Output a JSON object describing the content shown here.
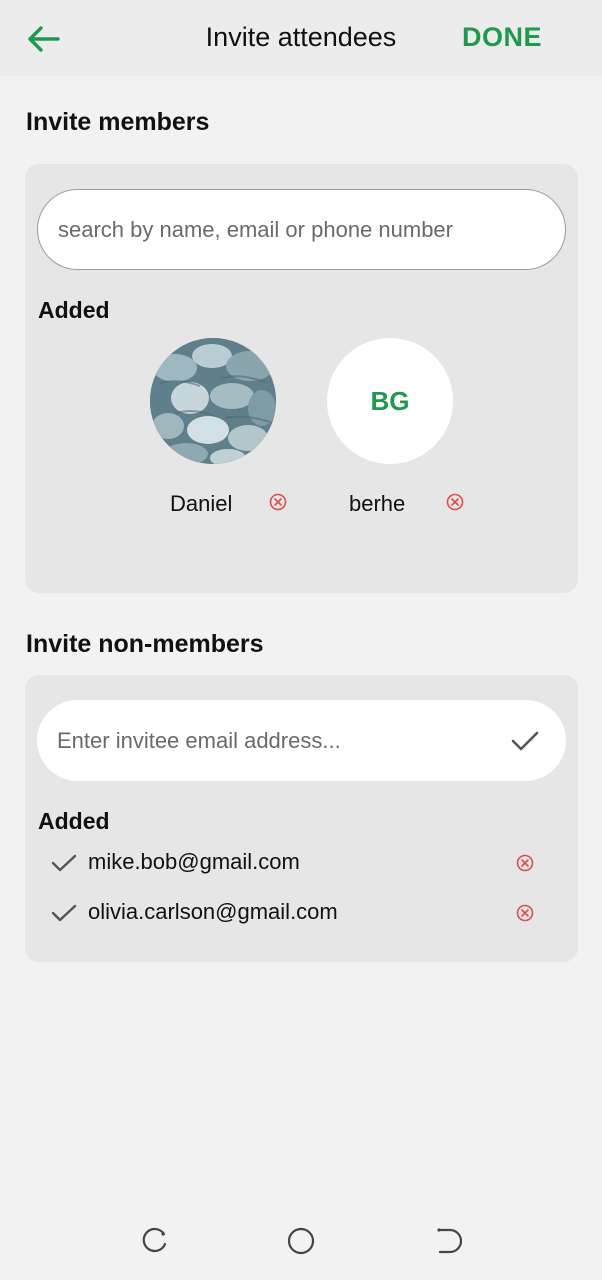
{
  "appbar": {
    "back_icon": "arrow-left-icon",
    "title": "Invite attendees",
    "done_label": "DONE"
  },
  "colors": {
    "accent": "#1e9a4e",
    "remove": "#e24b4b",
    "card": "#e6e6e6",
    "page_bg": "#f2f2f2"
  },
  "members": {
    "title": "Invite members",
    "search_placeholder": "search by name, email or phone number",
    "added_label": "Added",
    "added": [
      {
        "name": "Daniel",
        "avatar_type": "photo",
        "remove_icon": "remove-circle-icon"
      },
      {
        "name": "berhe",
        "avatar_type": "initials",
        "initials": "BG",
        "remove_icon": "remove-circle-icon"
      }
    ]
  },
  "non_members": {
    "title": "Invite non-members",
    "email_placeholder": "Enter invitee email address...",
    "confirm_icon": "check-icon",
    "added_label": "Added",
    "added": [
      {
        "email": "mike.bob@gmail.com"
      },
      {
        "email": "olivia.carlson@gmail.com"
      }
    ]
  },
  "system_nav": {
    "recent_icon": "recent-apps-icon",
    "home_icon": "home-circle-icon",
    "back_icon": "system-back-icon"
  }
}
